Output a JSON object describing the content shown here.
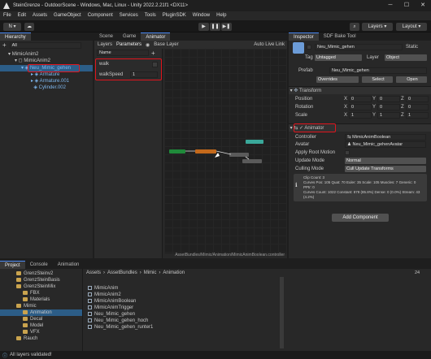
{
  "window": {
    "title": "SteinGrenze - OutdoorScene - Windows, Mac, Linux - Unity 2022.2.21f1 <DX11>",
    "minimize": "─",
    "maximize": "☐",
    "close": "✕"
  },
  "menu": [
    "File",
    "Edit",
    "Assets",
    "GameObject",
    "Component",
    "Services",
    "Tools",
    "PluginSDK",
    "Window",
    "Help"
  ],
  "toolbar": {
    "account": "N",
    "cloud": "☁",
    "play": "▶",
    "pause": "❚❚",
    "step": "▶❚",
    "search": "⌕",
    "layers": "Layers",
    "layout": "Layout"
  },
  "hierarchy": {
    "tab": "Hierarchy",
    "add": "+",
    "search_placeholder": "All",
    "items": [
      {
        "label": "MimicAnim2",
        "depth": 0,
        "kind": "scene"
      },
      {
        "label": "MimicAnim2",
        "depth": 1,
        "kind": "object"
      },
      {
        "label": "Neu_Mimic_gehen",
        "depth": 2,
        "kind": "prefab",
        "selected": true
      },
      {
        "label": "Armature",
        "depth": 3,
        "kind": "prefab"
      },
      {
        "label": "Armature.001",
        "depth": 3,
        "kind": "prefab"
      },
      {
        "label": "Cylinder.002",
        "depth": 3,
        "kind": "prefab"
      }
    ]
  },
  "animator": {
    "tabs": [
      "Scene",
      "Game",
      "Animator"
    ],
    "sub_tabs": [
      "Layers",
      "Parameters"
    ],
    "eye": "◉",
    "base_layer": "Base Layer",
    "auto_live": "Auto Live Link",
    "params_search": "Name",
    "params": [
      {
        "name": "walk",
        "type": "bool",
        "value": false
      },
      {
        "name": "walkSpeed",
        "type": "float",
        "value": "1"
      }
    ],
    "path": "AssetBundles/Mimic/Animation/MimicAnimBoolean.controller",
    "colors": {
      "entry": "#1f8a3a",
      "default": "#c4691b",
      "state": "#5a5a5a",
      "any": "#3aa89a"
    }
  },
  "inspector": {
    "tabs": [
      "Inspector",
      "SDF Bake Tool"
    ],
    "name": "Neu_Mimic_gehen",
    "static": "Static",
    "tag_label": "Tag",
    "tag": "Untagged",
    "layer_label": "Layer",
    "layer": "Object",
    "prefab_label": "Prefab",
    "prefab_name": "Neu_Mimic_gehen",
    "overrides": "Overrides",
    "select": "Select",
    "open": "Open",
    "transform": {
      "title": "Transform",
      "rows": [
        {
          "label": "Position",
          "x": "0",
          "y": "0",
          "z": "0"
        },
        {
          "label": "Rotation",
          "x": "0",
          "y": "0",
          "z": "0"
        },
        {
          "label": "Scale",
          "x": "1",
          "y": "1",
          "z": "1"
        }
      ]
    },
    "animator": {
      "title": "Animator",
      "controller_label": "Controller",
      "controller": "MimicAnimBoolean",
      "avatar_label": "Avatar",
      "avatar": "Neu_Mimic_gehenAvatar",
      "root_motion_label": "Apply Root Motion",
      "update_label": "Update Mode",
      "update": "Normal",
      "culling_label": "Culling Mode",
      "culling": "Cull Update Transforms",
      "info": [
        "Clip Count: 3",
        "Curves Pos: 105 Quat: 70 Euler: 35 Scale: 105 Muscles: 7 Generic: 0 PPtr: 0",
        "Curves Count: 1022 Constant: 879 (85.8%) Dense: 0 (0.0%) Stream: 43 (4.2%)"
      ]
    },
    "add_component": "Add Component"
  },
  "project": {
    "tabs": [
      "Project",
      "Console",
      "Animation"
    ],
    "breadcrumb": [
      "Assets",
      "AssetBundles",
      "Mimic",
      "Animation"
    ],
    "tree": [
      {
        "label": "GrenzSteinv2",
        "depth": 1
      },
      {
        "label": "GrenzSteinBasis",
        "depth": 1
      },
      {
        "label": "GrenzSteinMix",
        "depth": 1
      },
      {
        "label": "FBX",
        "depth": 2
      },
      {
        "label": "Materials",
        "depth": 2
      },
      {
        "label": "Mimic",
        "depth": 1
      },
      {
        "label": "Animation",
        "depth": 2,
        "selected": true
      },
      {
        "label": "Decal",
        "depth": 2
      },
      {
        "label": "Model",
        "depth": 2
      },
      {
        "label": "VFX",
        "depth": 2
      },
      {
        "label": "Rauch",
        "depth": 1
      }
    ],
    "files": [
      "MimicAnim",
      "MimicAnim2",
      "MimicAnimBoolean",
      "MimicAnimTrigger",
      "Neu_Mimic_gehen",
      "Neu_Mimic_gehen_hoch",
      "Neu_Mimic_gehen_runter1"
    ],
    "count": "24"
  },
  "status": {
    "text": "All layers validated!"
  }
}
